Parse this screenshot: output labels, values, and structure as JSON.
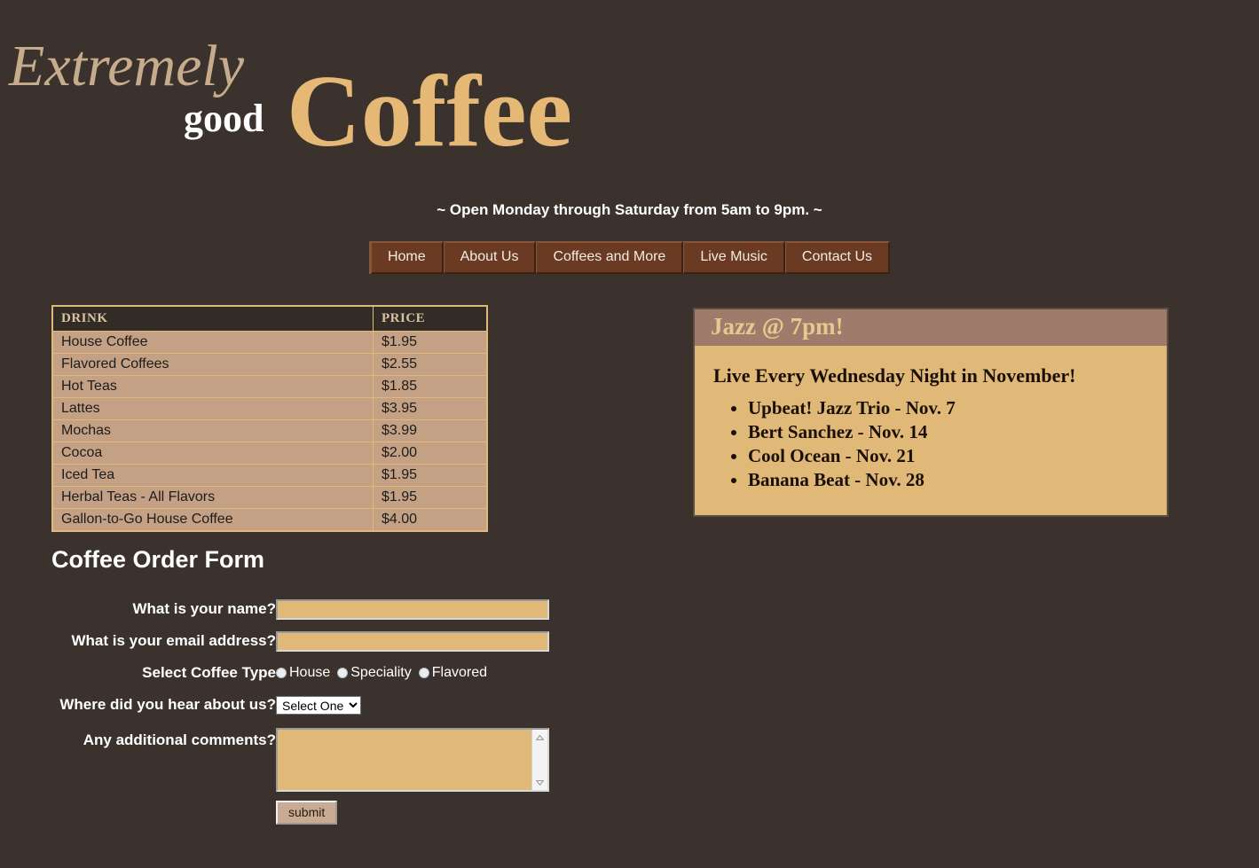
{
  "brand": {
    "extremely": "Extremely",
    "good": "good",
    "coffee": "Coffee",
    "colors": {
      "page_bg": "#3b322d",
      "coffee_gold": "#e6b876",
      "extremely_tan": "#c7ab8d",
      "nav_bg": "#6a3a22",
      "table_body": "#c4a184",
      "jazz_header": "#a07b6c",
      "jazz_body": "#e0b878"
    }
  },
  "tagline": "~ Open Monday through Saturday from 5am to 9pm. ~",
  "nav": {
    "items": [
      {
        "label": "Home"
      },
      {
        "label": "About Us"
      },
      {
        "label": "Coffees and More"
      },
      {
        "label": "Live Music"
      },
      {
        "label": "Contact Us"
      }
    ]
  },
  "price_table": {
    "headers": [
      "DRINK",
      "PRICE"
    ],
    "rows": [
      {
        "drink": "House Coffee",
        "price": "$1.95"
      },
      {
        "drink": "Flavored Coffees",
        "price": "$2.55"
      },
      {
        "drink": "Hot Teas",
        "price": "$1.85"
      },
      {
        "drink": "Lattes",
        "price": "$3.95"
      },
      {
        "drink": "Mochas",
        "price": "$3.99"
      },
      {
        "drink": "Cocoa",
        "price": "$2.00"
      },
      {
        "drink": "Iced Tea",
        "price": "$1.95"
      },
      {
        "drink": "Herbal Teas - All Flavors",
        "price": "$1.95"
      },
      {
        "drink": "Gallon-to-Go House Coffee",
        "price": "$4.00"
      }
    ]
  },
  "jazz": {
    "header": "Jazz @ 7pm!",
    "subtitle": "Live Every Wednesday Night in November!",
    "acts": [
      "Upbeat! Jazz Trio - Nov. 7",
      "Bert Sanchez - Nov. 14",
      "Cool Ocean - Nov. 21",
      "Banana Beat - Nov. 28"
    ]
  },
  "form": {
    "title": "Coffee Order Form",
    "name_label": "What is your name?",
    "name_value": "",
    "name_placeholder": "",
    "email_label": "What is your email address?",
    "email_value": "",
    "email_placeholder": "",
    "coffee_type_label": "Select Coffee Type",
    "coffee_types": [
      "House",
      "Speciality",
      "Flavored"
    ],
    "source_label": "Where did you hear about us?",
    "source_selected": "Select One",
    "source_options": [
      "Select One"
    ],
    "comments_label": "Any additional comments?",
    "comments_value": "",
    "comments_placeholder": "",
    "submit_label": "submit"
  }
}
